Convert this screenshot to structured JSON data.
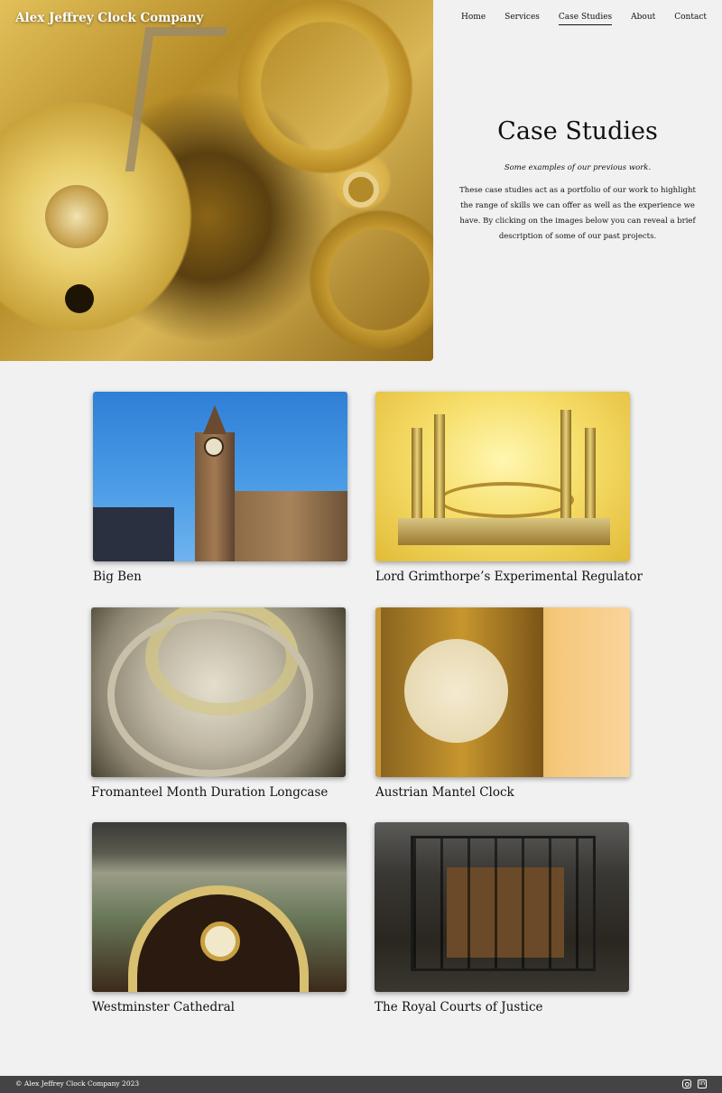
{
  "header": {
    "logo": "Alex Jeffrey Clock Company",
    "nav": [
      {
        "label": "Home"
      },
      {
        "label": "Services"
      },
      {
        "label": "Case Studies",
        "active": true
      },
      {
        "label": "About"
      },
      {
        "label": "Contact"
      }
    ]
  },
  "hero": {
    "title": "Case Studies",
    "subtitle": "Some examples of our previous work.",
    "description": "These case studies act as a portfolio of our work to highlight the range of skills we can offer as well as the experience we have. By clicking on the images below you can reveal a brief description of some of our past projects."
  },
  "case_studies": [
    {
      "title": "Big Ben"
    },
    {
      "title": "Lord Grimthorpe’s Experimental Regulator"
    },
    {
      "title": "Fromanteel Month Duration Longcase"
    },
    {
      "title": "Austrian Mantel Clock"
    },
    {
      "title": "Westminster Cathedral"
    },
    {
      "title": "The Royal Courts of Justice"
    }
  ],
  "footer": {
    "copyright": "© Alex Jeffrey Clock Company 2023",
    "icons": [
      "instagram-icon",
      "linkedin-icon"
    ]
  }
}
